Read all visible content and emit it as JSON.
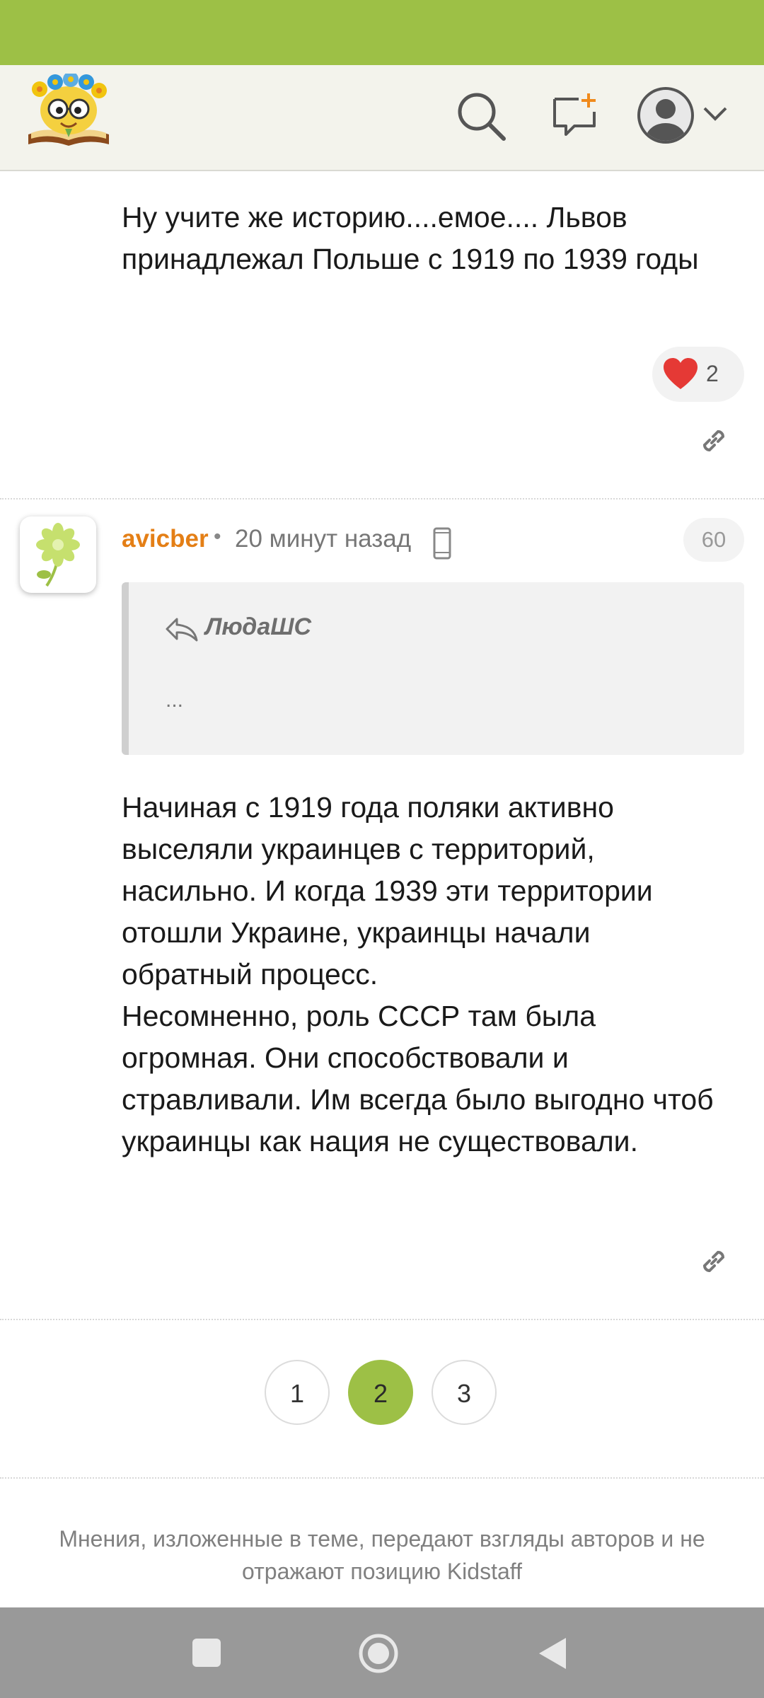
{
  "post1": {
    "text": "Ну учите же историю....емое.... Львов принадлежал Польше с 1919 по 1939 годы",
    "reaction_count": "2"
  },
  "post2": {
    "author": "avicber",
    "separator": "•",
    "time": "20 минут назад",
    "number": "60",
    "quote": {
      "author": "ЛюдаШС",
      "text": "..."
    },
    "text": "Начиная с 1919 года поляки активно выселяли украинцев с территорий, насильно. И когда 1939 эти территории отошли Украине, украинцы начали обратный процесс.\nНесомненно, роль СССР там была огромная. Они способствовали и стравливали. Им всегда было выгодно чтоб украинцы как нация не существовали."
  },
  "pagination": {
    "pages": [
      "1",
      "2",
      "3"
    ],
    "current": "2"
  },
  "disclaimer": "Мнения, изложенные в теме, передают взгляды авторов и не отражают позицию Kidstaff",
  "colors": {
    "brand_green": "#9dc046",
    "author_orange": "#e47f16",
    "new_post_plus": "#f08a1c"
  },
  "icons": [
    "logo",
    "search-icon",
    "new-post-icon",
    "user-avatar-icon",
    "chevron-down-icon",
    "heart-icon",
    "link-icon",
    "reply-icon",
    "mobile-device-icon",
    "nav-recents-icon",
    "nav-home-icon",
    "nav-back-icon"
  ]
}
